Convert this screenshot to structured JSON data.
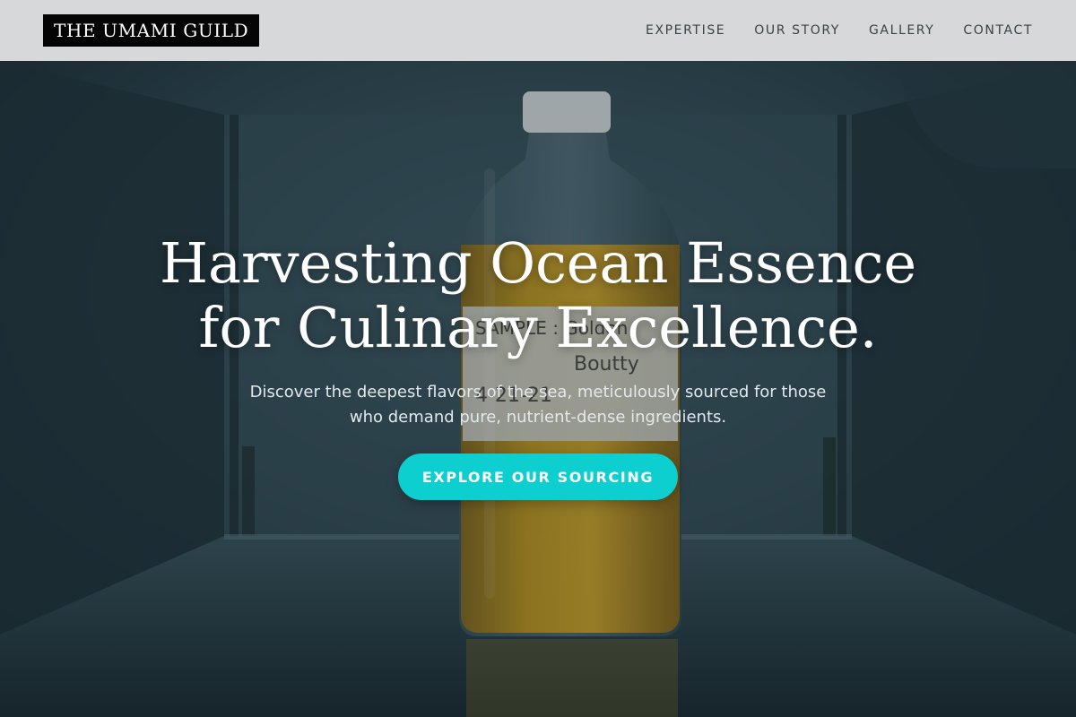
{
  "header": {
    "logo": "THE UMAMI GUILD",
    "nav": [
      "EXPERTISE",
      "OUR STORY",
      "GALLERY",
      "CONTACT"
    ]
  },
  "hero": {
    "title_lines": [
      "Harvesting Ocean Essence",
      "for Culinary Excellence."
    ],
    "subtitle_lines": [
      "Discover the deepest flavors of the sea, meticulously sourced for those",
      "who demand pure, nutrient-dense ingredients."
    ],
    "cta_label": "EXPLORE OUR SOURCING",
    "background_image": "glass bottle of amber liquid with handwritten label inside a refrigerator",
    "background_label_text": [
      "SAMPLE : Golden",
      "Boutty",
      "4-21-21"
    ]
  },
  "colors": {
    "header_bg": "#d6d8d9",
    "logo_bg": "#050505",
    "nav_text": "#3b4246",
    "cta_bg": "#0ecfcf",
    "hero_text": "#ffffff"
  }
}
